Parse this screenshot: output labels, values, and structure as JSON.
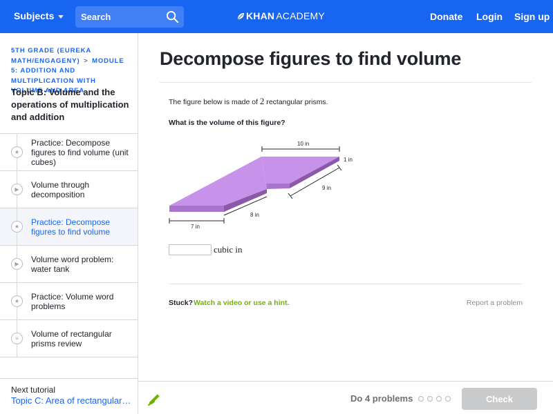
{
  "header": {
    "subjects_label": "Subjects",
    "search_placeholder": "Search",
    "logo_text_bold": "KHAN",
    "logo_text_light": "ACADEMY",
    "donate_label": "Donate",
    "login_label": "Login",
    "signup_label": "Sign up",
    "brand_color": "#1865f2"
  },
  "sidebar": {
    "breadcrumb_part1": "5TH GRADE (EUREKA MATH/ENGAGENY)",
    "breadcrumb_separator": ">",
    "breadcrumb_part2": "MODULE 5: ADDITION AND MULTIPLICATION WITH VOLUME AND AREA",
    "topic_title": "Topic B: Volume and the operations of multiplication and addition",
    "items": [
      {
        "label": "Practice: Decompose figures to find volume (unit cubes)",
        "icon": "star-icon",
        "active": false
      },
      {
        "label": "Volume through decomposition",
        "icon": "play-icon",
        "active": false
      },
      {
        "label": "Practice: Decompose figures to find volume",
        "icon": "star-icon",
        "active": true
      },
      {
        "label": "Volume word problem: water tank",
        "icon": "play-icon",
        "active": false
      },
      {
        "label": "Practice: Volume word problems",
        "icon": "star-icon",
        "active": false
      },
      {
        "label": "Volume of rectangular prisms review",
        "icon": "article-icon",
        "active": false
      }
    ],
    "next_tutorial_label": "Next tutorial",
    "next_tutorial_title": "Topic C: Area of rectangular figures with fractional side lengths"
  },
  "main": {
    "title": "Decompose figures to find volume",
    "intro_before": "The figure below is made of ",
    "intro_number": "2",
    "intro_after": " rectangular prisms.",
    "question": "What is the volume of this figure?",
    "figure": {
      "labels": {
        "top_width": "10 in",
        "height": "1 in",
        "right_depth": "9 in",
        "front_depth": "8 in",
        "front_width": "7 in"
      },
      "top_color": "#c792ea",
      "side_color": "#8a5aa8",
      "front_color": "#a874cc"
    },
    "answer_unit": "cubic in",
    "stuck_label": "Stuck?",
    "stuck_link": "Watch a video or use a hint.",
    "report_label": "Report a problem"
  },
  "footer": {
    "do_problems": "Do 4 problems",
    "progress_total": 4,
    "progress_done": 0,
    "check_label": "Check"
  }
}
